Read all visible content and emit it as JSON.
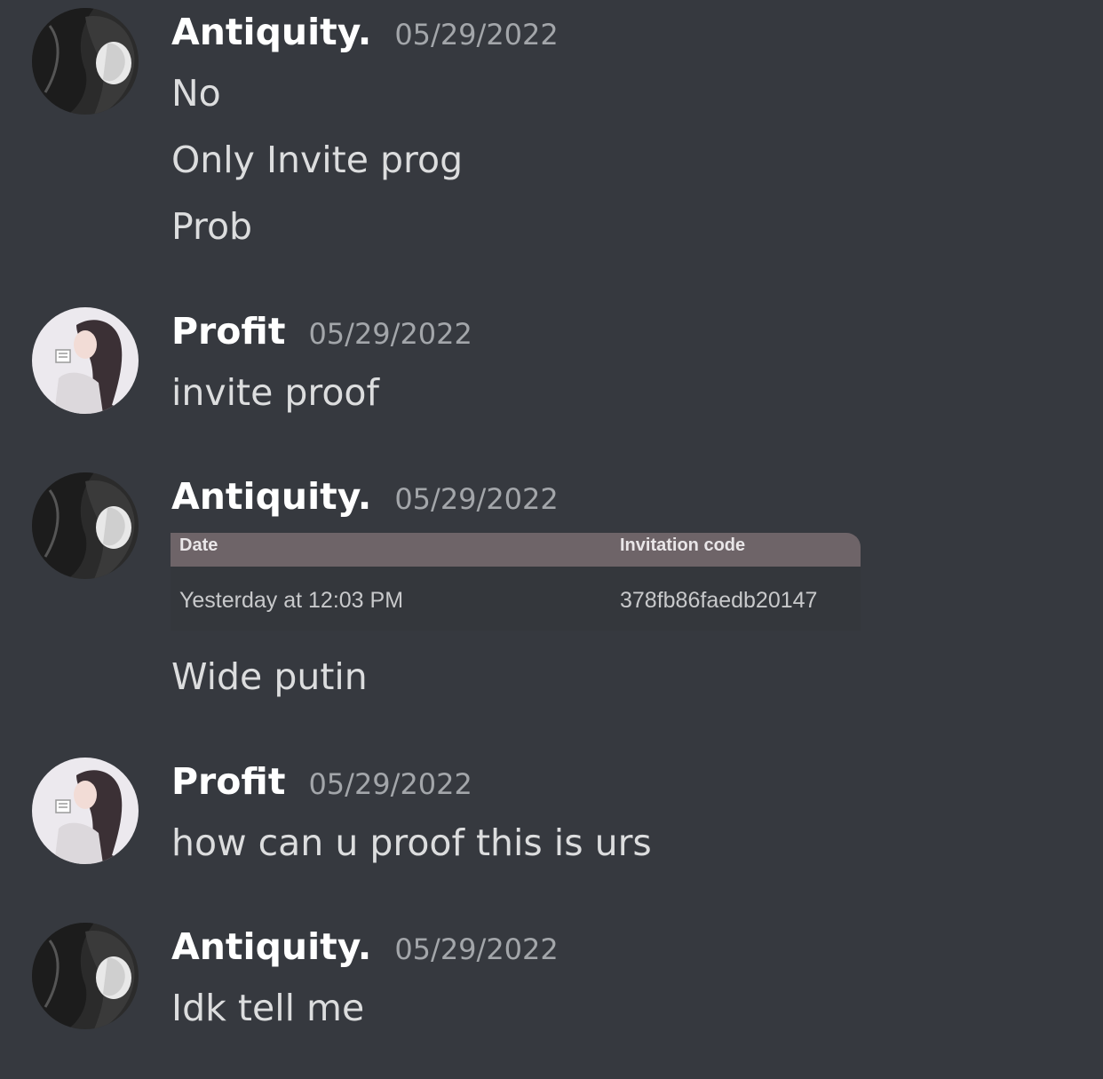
{
  "messages": [
    {
      "author": "Antiquity.",
      "timestamp": "05/29/2022",
      "avatar": "dark-hair-avatar",
      "lines": [
        "No",
        "Only Invite prog",
        "Prob"
      ]
    },
    {
      "author": "Profit",
      "timestamp": "05/29/2022",
      "avatar": "light-portrait-avatar",
      "lines": [
        "invite proof"
      ]
    },
    {
      "author": "Antiquity.",
      "timestamp": "05/29/2022",
      "avatar": "dark-hair-avatar",
      "attachment": {
        "headers": [
          "Date",
          "Invitation code"
        ],
        "row": [
          "Yesterday at 12:03 PM",
          "378fb86faedb20147"
        ]
      },
      "lines": [
        "Wide putin"
      ]
    },
    {
      "author": "Profit",
      "timestamp": "05/29/2022",
      "avatar": "light-portrait-avatar",
      "lines": [
        "how can u proof this is urs"
      ]
    },
    {
      "author": "Antiquity.",
      "timestamp": "05/29/2022",
      "avatar": "dark-hair-avatar",
      "lines": [
        "Idk tell me"
      ]
    }
  ],
  "colors": {
    "background": "#36393f",
    "username": "#ffffff",
    "timestamp": "#a3a6aa",
    "message_text": "#dcddde",
    "attachment_header": "#6e6468"
  }
}
